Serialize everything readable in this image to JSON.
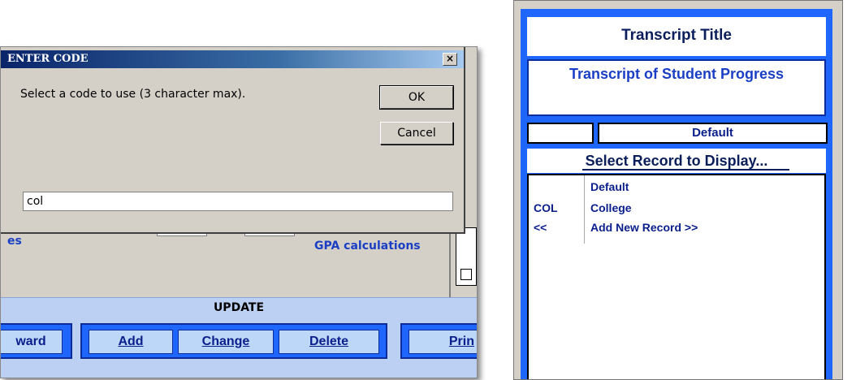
{
  "dialog": {
    "title": "ENTER CODE",
    "close_label": "×",
    "prompt": "Select a code to use (3 character max).",
    "ok_label": "OK",
    "cancel_label": "Cancel",
    "input_value": "col"
  },
  "background_form": {
    "partial_label": "es",
    "gpa_label": "GPA calculations",
    "update_label": "UPDATE",
    "buttons": {
      "forward_partial": "ward",
      "add": "Add",
      "change": "Change",
      "delete": "Delete",
      "print_partial": "Prin"
    }
  },
  "transcript_panel": {
    "title": "Transcript Title",
    "transcript_text": "Transcript of Student Progress",
    "code_value": "",
    "default_label": "Default",
    "select_label": "Select Record to Display...",
    "records": [
      {
        "code": "",
        "name": "Default"
      },
      {
        "code": "COL",
        "name": "College"
      },
      {
        "code": "<<",
        "name": "Add New Record >>"
      }
    ]
  },
  "colors": {
    "dialog_bg": "#d4d0c8",
    "title_bar_start": "#0a246a",
    "frame_blue": "#1f66ff",
    "button_bg": "#bcd7f7",
    "text_blue": "#0a1e8c"
  }
}
